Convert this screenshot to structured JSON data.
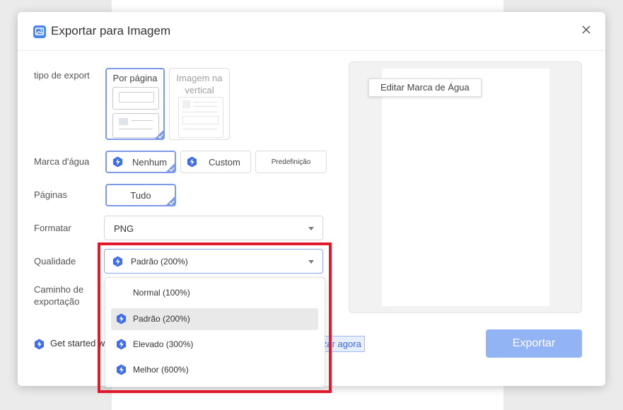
{
  "dialog": {
    "title": "Exportar para Imagem",
    "title_icon": "image-export-icon",
    "close_icon": "close-icon"
  },
  "form": {
    "export_type": {
      "label": "tipo de export",
      "options": [
        {
          "label": "Por página",
          "selected": true
        },
        {
          "label": "Imagem na vertical",
          "selected": false
        }
      ]
    },
    "watermark": {
      "label": "Marca d'água",
      "options": [
        {
          "label": "Nenhum",
          "selected": true,
          "icon": "lightning-icon"
        },
        {
          "label": "Custom",
          "selected": false,
          "icon": "lightning-icon"
        },
        {
          "label": "Predefinição",
          "selected": false
        }
      ]
    },
    "pages": {
      "label": "Páginas",
      "options": [
        {
          "label": "Tudo",
          "selected": true
        }
      ]
    },
    "format": {
      "label": "Formatar",
      "value": "PNG"
    },
    "quality": {
      "label": "Qualidade",
      "value": "Padrão (200%)",
      "options": [
        {
          "label": "Normal (100%)",
          "premium": false,
          "active": false
        },
        {
          "label": "Padrão (200%)",
          "premium": true,
          "active": true
        },
        {
          "label": "Elevado (300%)",
          "premium": true,
          "active": false
        },
        {
          "label": "Melhor (600%)",
          "premium": true,
          "active": false
        }
      ]
    },
    "path": {
      "label_line1": "Caminho de",
      "label_line2": "exportação"
    }
  },
  "promo": {
    "text": "Get started w",
    "link": "izar agora"
  },
  "preview": {
    "watermark_button": "Editar Marca de Água"
  },
  "actions": {
    "export_label": "Exportar"
  },
  "colors": {
    "accent": "#7c9ae8",
    "export_button": "#93b4f4",
    "highlight": "#e11a2b",
    "bolt": "#3f6ee8"
  }
}
